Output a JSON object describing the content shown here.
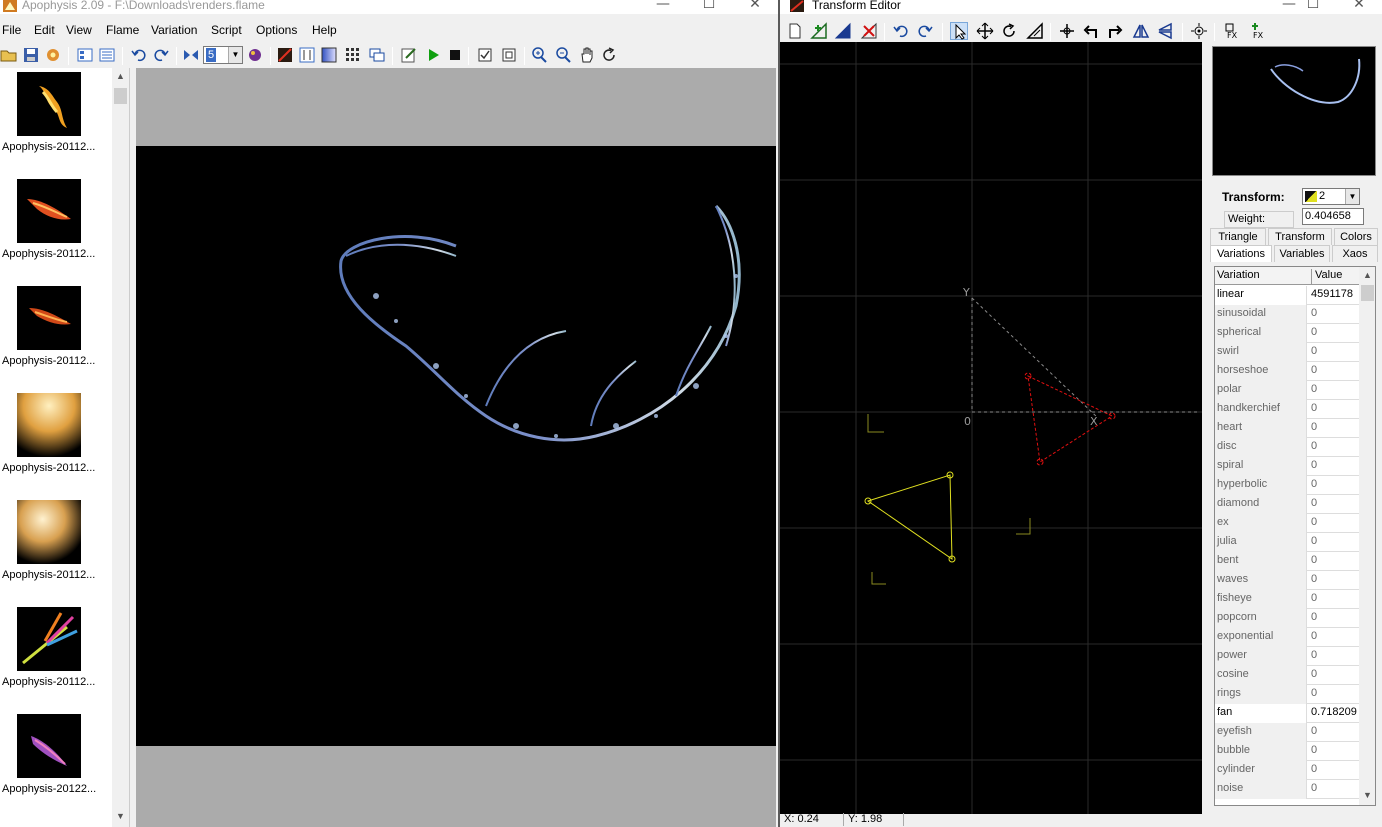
{
  "main": {
    "title": "Apophysis 2.09 - F:\\Downloads\\renders.flame",
    "menu": [
      "File",
      "Edit",
      "View",
      "Flame",
      "Variation",
      "Script",
      "Options",
      "Help"
    ],
    "toolbar_combo_value": "5",
    "thumbnails": [
      {
        "label": "Apophysis-20112...",
        "palette": "fire"
      },
      {
        "label": "Apophysis-20112...",
        "palette": "ember"
      },
      {
        "label": "Apophysis-20112...",
        "palette": "ember"
      },
      {
        "label": "Apophysis-20112...",
        "palette": "gold"
      },
      {
        "label": "Apophysis-20112...",
        "palette": "gold"
      },
      {
        "label": "Apophysis-20112...",
        "palette": "rainbow"
      },
      {
        "label": "Apophysis-20122...",
        "palette": "violet"
      }
    ]
  },
  "editor": {
    "title": "Transform Editor",
    "transform_label": "Transform:",
    "transform_value": "2",
    "weight_label": "Weight:",
    "weight_value": "0.404658",
    "tabs_row1": [
      "Triangle",
      "Transform",
      "Colors"
    ],
    "tabs_row2": [
      "Variations",
      "Variables",
      "Xaos"
    ],
    "active_tab": "Variations",
    "table_headers": [
      "Variation",
      "Value"
    ],
    "variations": [
      {
        "name": "linear",
        "value": "4591178",
        "set": true
      },
      {
        "name": "sinusoidal",
        "value": "0",
        "set": false
      },
      {
        "name": "spherical",
        "value": "0",
        "set": false
      },
      {
        "name": "swirl",
        "value": "0",
        "set": false
      },
      {
        "name": "horseshoe",
        "value": "0",
        "set": false
      },
      {
        "name": "polar",
        "value": "0",
        "set": false
      },
      {
        "name": "handkerchief",
        "value": "0",
        "set": false
      },
      {
        "name": "heart",
        "value": "0",
        "set": false
      },
      {
        "name": "disc",
        "value": "0",
        "set": false
      },
      {
        "name": "spiral",
        "value": "0",
        "set": false
      },
      {
        "name": "hyperbolic",
        "value": "0",
        "set": false
      },
      {
        "name": "diamond",
        "value": "0",
        "set": false
      },
      {
        "name": "ex",
        "value": "0",
        "set": false
      },
      {
        "name": "julia",
        "value": "0",
        "set": false
      },
      {
        "name": "bent",
        "value": "0",
        "set": false
      },
      {
        "name": "waves",
        "value": "0",
        "set": false
      },
      {
        "name": "fisheye",
        "value": "0",
        "set": false
      },
      {
        "name": "popcorn",
        "value": "0",
        "set": false
      },
      {
        "name": "exponential",
        "value": "0",
        "set": false
      },
      {
        "name": "power",
        "value": "0",
        "set": false
      },
      {
        "name": "cosine",
        "value": "0",
        "set": false
      },
      {
        "name": "rings",
        "value": "0",
        "set": false
      },
      {
        "name": "fan",
        "value": "0.718209",
        "set": true
      },
      {
        "name": "eyefish",
        "value": "0",
        "set": false
      },
      {
        "name": "bubble",
        "value": "0",
        "set": false
      },
      {
        "name": "cylinder",
        "value": "0",
        "set": false
      },
      {
        "name": "noise",
        "value": "0",
        "set": false
      }
    ],
    "status_x": "X: 0.24",
    "status_y": "Y: 1.98",
    "canvas_labels": {
      "y_axis": "Y",
      "x_axis": "X",
      "origin": "0"
    }
  },
  "colors": {
    "accent": "#3a6cc4",
    "triangle_selected": "#e0e020",
    "triangle_other": "#e01010",
    "grid": "#2a2a2a"
  }
}
